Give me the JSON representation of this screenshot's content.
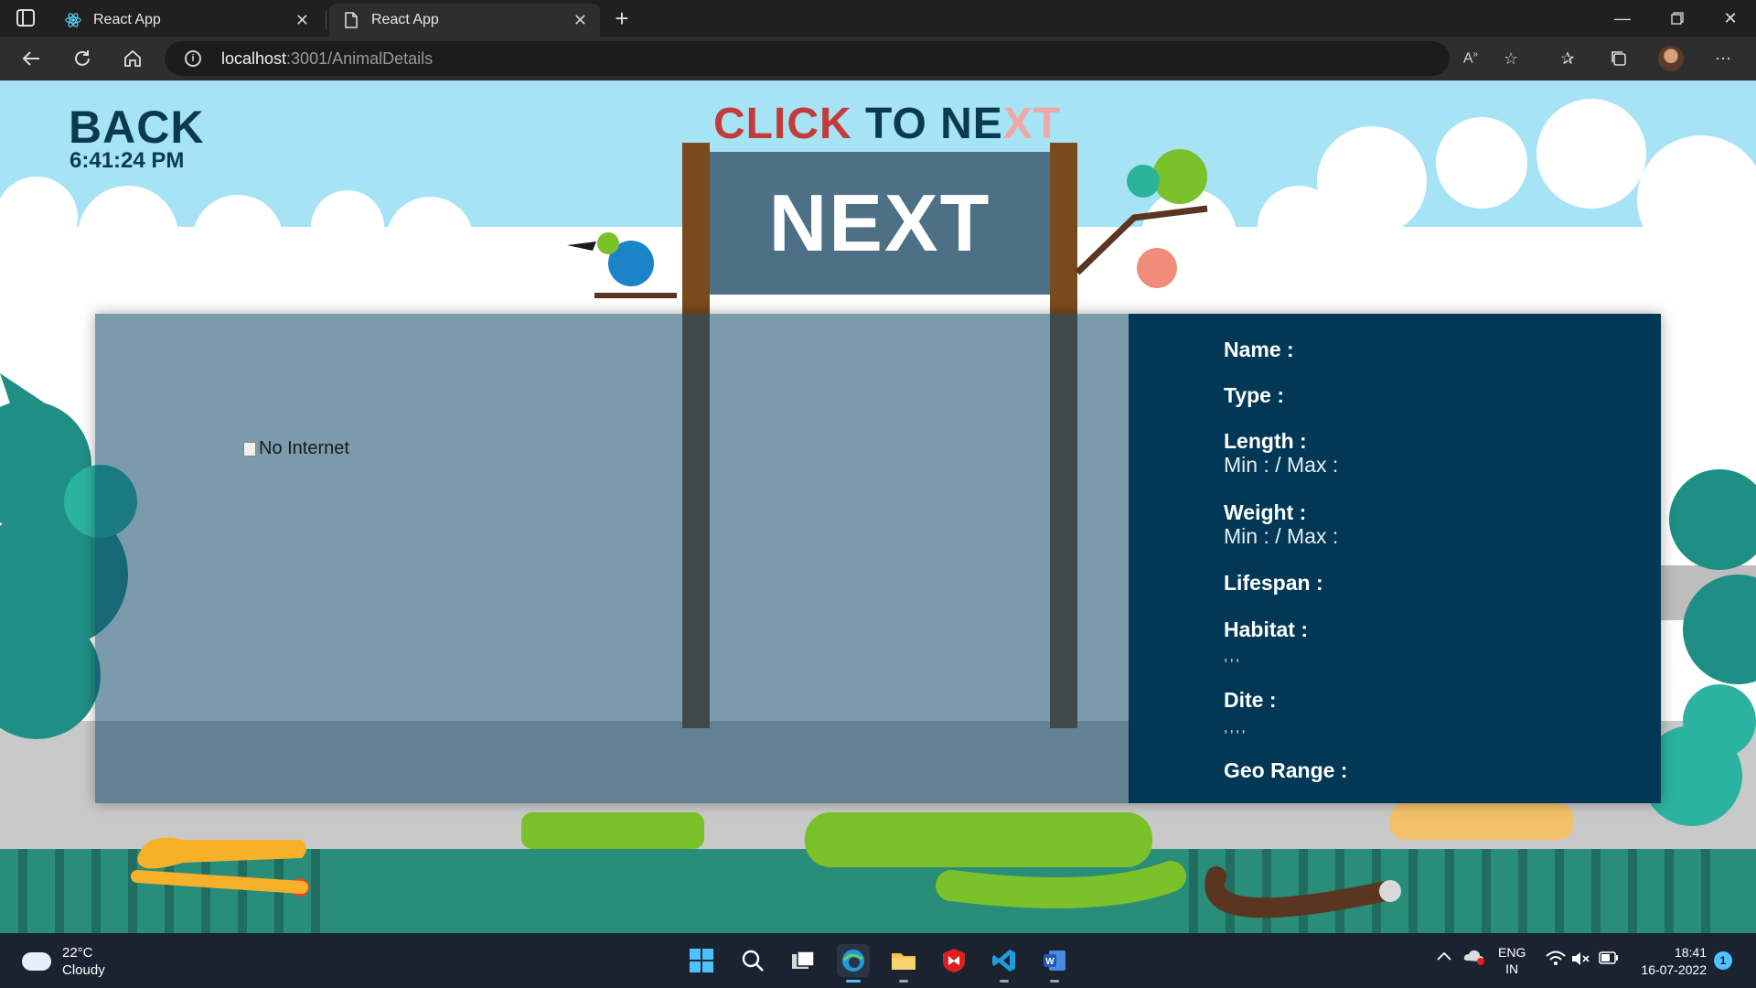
{
  "browser": {
    "tabs": [
      {
        "title": "React App",
        "icon": "react-icon",
        "active": false
      },
      {
        "title": "React App",
        "icon": "page-icon",
        "active": true
      }
    ],
    "address": {
      "host": "localhost",
      "rest": ":3001/AnimalDetails"
    }
  },
  "page": {
    "back_label": "BACK",
    "clock": "6:41:24 PM",
    "click_to_next": {
      "part1": "CLICK",
      "part2": " TO NE",
      "part3": "XT"
    },
    "next_label": "NEXT",
    "image_alt": "No Internet",
    "fields": {
      "name_label": "Name :",
      "type_label": "Type :",
      "length_label": "Length :",
      "length_value": "Min : / Max :",
      "weight_label": "Weight :",
      "weight_value": "Min : / Max :",
      "lifespan_label": "Lifespan :",
      "habitat_label": "Habitat :",
      "habitat_value": ",,,",
      "dite_label": "Dite :",
      "dite_value": ",,,,",
      "geo_label": "Geo Range :"
    },
    "colors": {
      "accent": "#023855",
      "title_red": "#c43b3b",
      "title_dark": "#0b3a4e"
    }
  },
  "taskbar": {
    "weather_temp": "22°C",
    "weather_desc": "Cloudy",
    "lang_top": "ENG",
    "lang_bottom": "IN",
    "time": "18:41",
    "date": "16-07-2022",
    "notification_count": "1"
  }
}
